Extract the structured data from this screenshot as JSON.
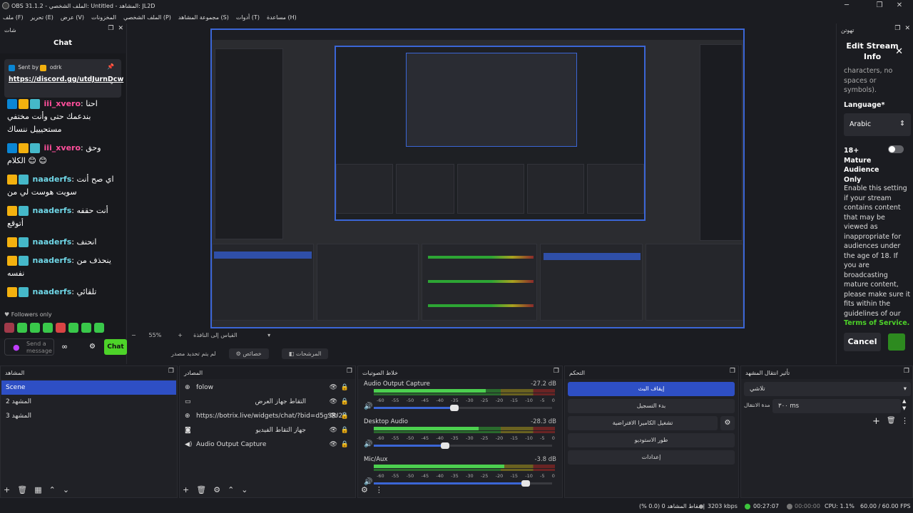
{
  "window": {
    "title": "OBS 31.1.2 - الملف الشخصي: Untitled - المشاهد: JL2D",
    "minimize": "─",
    "maximize": "❐",
    "close": "✕"
  },
  "menu": [
    "ملف (F)",
    "تحرير (E)",
    "عرض (V)",
    "المخزونات",
    "الملف الشخصي (P)",
    "مجموعة المشاهد (S)",
    "أدوات (T)",
    "مساعدة (H)"
  ],
  "chat_dock": {
    "header": "شات",
    "title": "Chat",
    "pinned": {
      "sent_by": "Sent by",
      "user": "odrk",
      "link": "https://discord.gg/utdJurnDcw"
    },
    "messages": [
      {
        "user": "iii_xvero",
        "sep": ":",
        "text": "احنا بندعمك حتى وأنت مختفي مستحيييل ننساك",
        "color": "#ff4f9b"
      },
      {
        "user": "iii_xvero",
        "sep": ":",
        "text": "وحق الكلام 😊 😊",
        "color": "#ff4f9b"
      },
      {
        "user": "naaderfs",
        "sep": ":",
        "text": "اي صح أنت سويت هوست لي من",
        "color": "#6fd6e6"
      },
      {
        "user": "naaderfs",
        "sep": ":",
        "text": "أنت حقفه أتوقع",
        "color": "#6fd6e6"
      },
      {
        "user": "naaderfs",
        "sep": ":",
        "text": "انحنف",
        "color": "#6fd6e6"
      },
      {
        "user": "naaderfs",
        "sep": ":",
        "text": "ينحذف من نفسه",
        "color": "#6fd6e6"
      },
      {
        "user": "naaderfs",
        "sep": ":",
        "text": "تلقائي",
        "color": "#6fd6e6"
      }
    ],
    "followers_only": "Followers only",
    "input_placeholder": "Send a message",
    "chat_button": "Chat",
    "infinity": "∞"
  },
  "preview": {
    "zoom": "55%",
    "scale_label": "القياس إلى النافذة",
    "no_tag": "لم يتم تحديد مصدر",
    "props_button": "خصائص",
    "filters_button": "المرشحات"
  },
  "edit_dock": {
    "header": "تهوتن",
    "title": "Edit Stream Info",
    "top_text": "characters, no spaces or symbols).",
    "language_label": "Language*",
    "language_value": "Arabic",
    "mature_label": "18+ Mature Audience Only",
    "description": "Enable this setting if your stream contains content that may be viewed as inappropriate for audiences under the age of 18. If you are broadcasting mature content, please make sure it fits within the guidelines of our",
    "tos": "Terms of Service.",
    "cancel": "Cancel",
    "accent": "#4dd329"
  },
  "scenes": {
    "header": "المشاهد",
    "items": [
      "Scene",
      "المشهد 2",
      "المشهد 3"
    ]
  },
  "sources": {
    "header": "المصادر",
    "items": [
      {
        "label": "folow",
        "icon": "⊕"
      },
      {
        "label": "التقاط جهاز العرض",
        "icon": "▭"
      },
      {
        "label": "https://botrix.live/widgets/chat/?bid=d5gSIU2Y",
        "icon": "⊕"
      },
      {
        "label": "جهاز التقاط الفيديو",
        "icon": "◙"
      },
      {
        "label": "Audio Output Capture",
        "icon": "◀)"
      }
    ]
  },
  "mixer": {
    "header": "خلاط الصوتيات",
    "scale": [
      "-60",
      "-55",
      "-50",
      "-45",
      "-40",
      "-35",
      "-30",
      "-25",
      "-20",
      "-15",
      "-10",
      "-5",
      "0"
    ],
    "channels": [
      {
        "name": "Audio Output Capture",
        "db": "-27.2 dB",
        "level": 0.62,
        "volume": 0.45
      },
      {
        "name": "Desktop Audio",
        "db": "-28.3 dB",
        "level": 0.58,
        "volume": 0.4
      },
      {
        "name": "Mic/Aux",
        "db": "-3.8 dB",
        "level": 0.72,
        "volume": 0.85
      }
    ]
  },
  "controls": {
    "header": "التحكم",
    "buttons": [
      "إيقاف البث",
      "بدء التسجيل",
      "تشغيل الكاميرا الافتراضية",
      "طور الاستوديو",
      "إعدادات"
    ]
  },
  "transitions": {
    "header": "تأثير انتقال المشهد",
    "type": "تلاشي",
    "duration_label": "مدة الانتقال",
    "duration_value": "٣٠٠ ms"
  },
  "status": {
    "dropped": "إسقاط المشاهد 0 (0.0 %)",
    "bitrate": "3203 kbps",
    "live_time": "00:27:07",
    "rec_time": "00:00:00",
    "cpu": "CPU: 1.1%",
    "fps": "60.00 / 60.00 FPS"
  }
}
